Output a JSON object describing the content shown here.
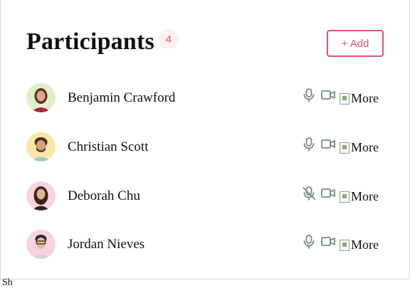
{
  "header": {
    "title": "Participants",
    "count": "4",
    "add_label": "+ Add"
  },
  "accent": "#d9536f",
  "icon_color": "#7b8493",
  "participants": [
    {
      "name": "Benjamin Crawford",
      "mic": "on",
      "camera": "on",
      "more_alt": "More",
      "avatar_bg": "#dff0c8"
    },
    {
      "name": "Christian Scott",
      "mic": "on",
      "camera": "on",
      "more_alt": "More",
      "avatar_bg": "#fbe7a8"
    },
    {
      "name": "Deborah Chu",
      "mic": "off",
      "camera": "on",
      "more_alt": "More",
      "avatar_bg": "#f9d3de"
    },
    {
      "name": "Jordan Nieves",
      "mic": "on",
      "camera": "on",
      "more_alt": "More",
      "avatar_bg": "#f9d3de"
    }
  ],
  "footer_text": "Sh"
}
